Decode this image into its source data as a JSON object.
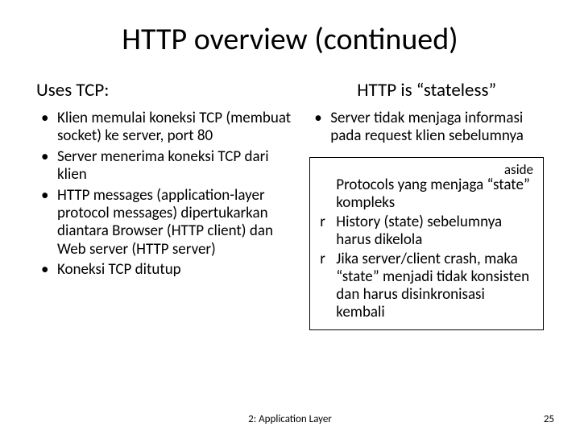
{
  "title": "HTTP overview (continued)",
  "left": {
    "heading": "Uses TCP:",
    "items": [
      "Klien memulai koneksi TCP (membuat socket) ke server, port 80",
      "Server menerima koneksi TCP dari klien",
      "HTTP messages (application-layer protocol messages) dipertukarkan diantara Browser (HTTP client) dan Web server (HTTP server)",
      "Koneksi TCP ditutup"
    ]
  },
  "right": {
    "heading": "HTTP is “stateless”",
    "items": [
      "Server tidak menjaga informasi pada request klien sebelumnya"
    ],
    "aside": {
      "label": "aside",
      "lead": "Protocols yang menjaga “state” kompleks",
      "points": [
        "History (state) sebelumnya harus dikelola",
        "Jika server/client crash, maka “state” menjadi tidak konsisten dan harus disinkronisasi kembali"
      ]
    }
  },
  "footer": {
    "center": "2: Application Layer",
    "page": "25"
  }
}
